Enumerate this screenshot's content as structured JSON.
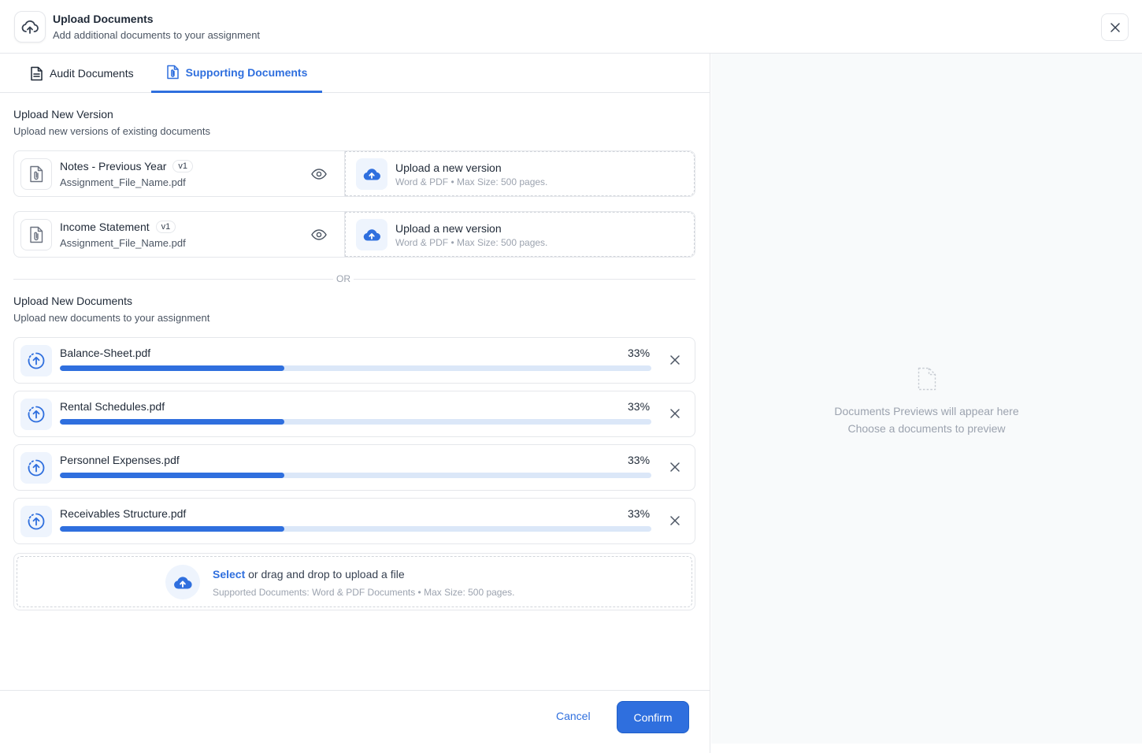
{
  "header": {
    "title": "Upload Documents",
    "subtitle": "Add additional documents to your assignment"
  },
  "tabs": [
    {
      "label": "Audit Documents",
      "active": false
    },
    {
      "label": "Supporting Documents",
      "active": true
    }
  ],
  "version_section": {
    "title": "Upload New Version",
    "subtitle": "Upload new versions of existing documents",
    "items": [
      {
        "name": "Notes - Previous Year",
        "version": "v1",
        "file": "Assignment_File_Name.pdf",
        "upload_title": "Upload a new version",
        "upload_sub": "Word & PDF • Max Size: 500 pages."
      },
      {
        "name": "Income Statement",
        "version": "v1",
        "file": "Assignment_File_Name.pdf",
        "upload_title": "Upload a new version",
        "upload_sub": "Word & PDF • Max Size: 500 pages."
      }
    ]
  },
  "divider_text": "OR",
  "new_section": {
    "title": "Upload New Documents",
    "subtitle": "Upload new documents to your assignment",
    "uploads": [
      {
        "name": "Balance-Sheet.pdf",
        "progress_label": "33%",
        "progress": 0.38
      },
      {
        "name": "Rental Schedules.pdf",
        "progress_label": "33%",
        "progress": 0.38
      },
      {
        "name": "Personnel Expenses.pdf",
        "progress_label": "33%",
        "progress": 0.38
      },
      {
        "name": "Receivables Structure.pdf",
        "progress_label": "33%",
        "progress": 0.38
      }
    ]
  },
  "dropzone": {
    "select_label": "Select",
    "line1_rest": " or drag and drop to upload a file",
    "line2": "Supported Documents: Word & PDF Documents • Max Size: 500 pages."
  },
  "footer": {
    "cancel_label": "Cancel",
    "confirm_label": "Confirm"
  },
  "preview": {
    "empty_title": "Documents Previews will appear here",
    "empty_sub": "Choose a documents to preview"
  },
  "colors": {
    "accent": "#2f6fde",
    "track": "#dbe7f8",
    "icon_bg": "#eef4fd",
    "preview_bg": "#f8fafb"
  },
  "icons": {
    "header": "cloud-upload-icon",
    "close": "close-icon",
    "audit_tab": "document-icon",
    "support_tab": "attachment-document-icon",
    "file": "attachment-file-icon",
    "view": "eye-icon",
    "upload": "cloud-upload-filled-icon",
    "uploading": "circular-upload-icon",
    "remove": "close-icon",
    "empty_preview": "file-dashed-icon"
  }
}
